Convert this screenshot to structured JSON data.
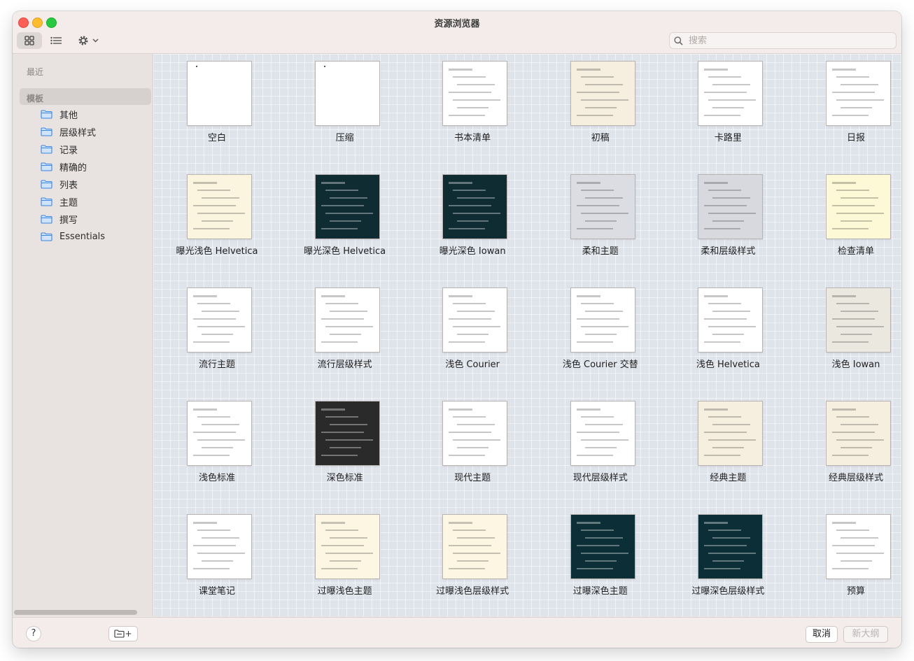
{
  "window": {
    "title": "资源浏览器"
  },
  "toolbar": {
    "search_placeholder": "搜索",
    "grid_view": "grid-view-icon",
    "list_view": "list-view-icon",
    "settings": "gear-icon"
  },
  "sidebar": {
    "recent_label": "最近",
    "section_label": "模板",
    "items": [
      {
        "label": "其他"
      },
      {
        "label": "层级样式"
      },
      {
        "label": "记录"
      },
      {
        "label": "精确的"
      },
      {
        "label": "列表"
      },
      {
        "label": "主题"
      },
      {
        "label": "撰写"
      },
      {
        "label": "Essentials"
      }
    ]
  },
  "templates": [
    {
      "name": "空白",
      "bg": "#ffffff"
    },
    {
      "name": "压缩",
      "bg": "#ffffff"
    },
    {
      "name": "书本清单",
      "bg": "#ffffff"
    },
    {
      "name": "初稿",
      "bg": "#f6efdf"
    },
    {
      "name": "卡路里",
      "bg": "#ffffff"
    },
    {
      "name": "日报",
      "bg": "#ffffff"
    },
    {
      "name": "曝光浅色 Helvetica",
      "bg": "#fbf4df"
    },
    {
      "name": "曝光深色 Helvetica",
      "bg": "#0f2c33"
    },
    {
      "name": "曝光深色 Iowan",
      "bg": "#0f2c33"
    },
    {
      "name": "柔和主题",
      "bg": "#dcdde3"
    },
    {
      "name": "柔和层级样式",
      "bg": "#d7d9df"
    },
    {
      "name": "检查清单",
      "bg": "#fdf8d6"
    },
    {
      "name": "流行主题",
      "bg": "#ffffff"
    },
    {
      "name": "流行层级样式",
      "bg": "#ffffff"
    },
    {
      "name": "浅色 Courier",
      "bg": "#ffffff"
    },
    {
      "name": "浅色 Courier 交替",
      "bg": "#ffffff"
    },
    {
      "name": "浅色 Helvetica",
      "bg": "#ffffff"
    },
    {
      "name": "浅色 Iowan",
      "bg": "#ebe9df"
    },
    {
      "name": "浅色标准",
      "bg": "#ffffff"
    },
    {
      "name": "深色标准",
      "bg": "#2a2a2a"
    },
    {
      "name": "现代主题",
      "bg": "#ffffff"
    },
    {
      "name": "现代层级样式",
      "bg": "#ffffff"
    },
    {
      "name": "经典主题",
      "bg": "#f6efdf"
    },
    {
      "name": "经典层级样式",
      "bg": "#f6efdf"
    },
    {
      "name": "课堂笔记",
      "bg": "#ffffff"
    },
    {
      "name": "过曝浅色主题",
      "bg": "#fdf6e3"
    },
    {
      "name": "过曝浅色层级样式",
      "bg": "#fdf6e3"
    },
    {
      "name": "过曝深色主题",
      "bg": "#0c2f37"
    },
    {
      "name": "过曝深色层级样式",
      "bg": "#0c2f37"
    },
    {
      "name": "预算",
      "bg": "#ffffff"
    }
  ],
  "footer": {
    "help_label": "?",
    "new_folder_label": "+",
    "cancel_label": "取消",
    "new_outline_label": "新大纲"
  }
}
